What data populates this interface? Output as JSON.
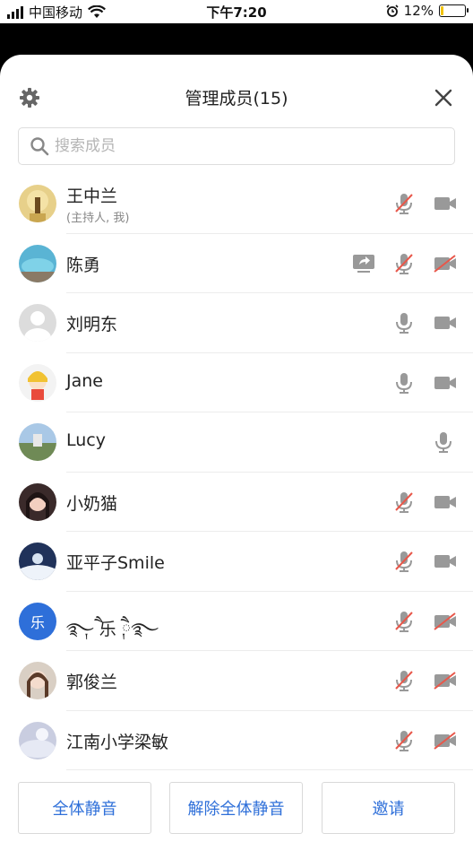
{
  "status_bar": {
    "carrier": "中国移动",
    "time": "下午7:20",
    "battery": "12%",
    "battery_level": 0.12
  },
  "header": {
    "title": "管理成员(15)",
    "settings_icon": "gear-icon",
    "close_icon": "close-icon"
  },
  "search": {
    "placeholder": "搜索成员",
    "value": ""
  },
  "members": [
    {
      "name": "王中兰",
      "subtitle": "(主持人, 我)",
      "mic": "muted",
      "camera": "on",
      "sharing": false
    },
    {
      "name": "陈勇",
      "subtitle": "",
      "mic": "muted",
      "camera": "off",
      "sharing": true
    },
    {
      "name": "刘明东",
      "subtitle": "",
      "mic": "on",
      "camera": "on",
      "sharing": false
    },
    {
      "name": "Jane",
      "subtitle": "",
      "mic": "on",
      "camera": "on",
      "sharing": false
    },
    {
      "name": "Lucy",
      "subtitle": "",
      "mic": "on",
      "camera": "none",
      "sharing": false
    },
    {
      "name": "小奶猫",
      "subtitle": "",
      "mic": "muted",
      "camera": "on",
      "sharing": false
    },
    {
      "name": "亚平子Smile",
      "subtitle": "",
      "mic": "muted",
      "camera": "on",
      "sharing": false
    },
    {
      "name": "࿐ཻ༙ 乐 ཻ༙࿐",
      "avatar_text": "乐",
      "subtitle": "",
      "mic": "muted",
      "camera": "off",
      "sharing": false
    },
    {
      "name": "郭俊兰",
      "subtitle": "",
      "mic": "muted",
      "camera": "off",
      "sharing": false
    },
    {
      "name": "江南小学梁敏",
      "subtitle": "",
      "mic": "muted",
      "camera": "off",
      "sharing": false
    }
  ],
  "footer": {
    "mute_all": "全体静音",
    "unmute_all": "解除全体静音",
    "invite": "邀请"
  },
  "colors": {
    "accent": "#2e6fd9",
    "icon_gray": "#999999",
    "muted_red": "#e8574a",
    "battery_yellow": "#f2c200"
  }
}
